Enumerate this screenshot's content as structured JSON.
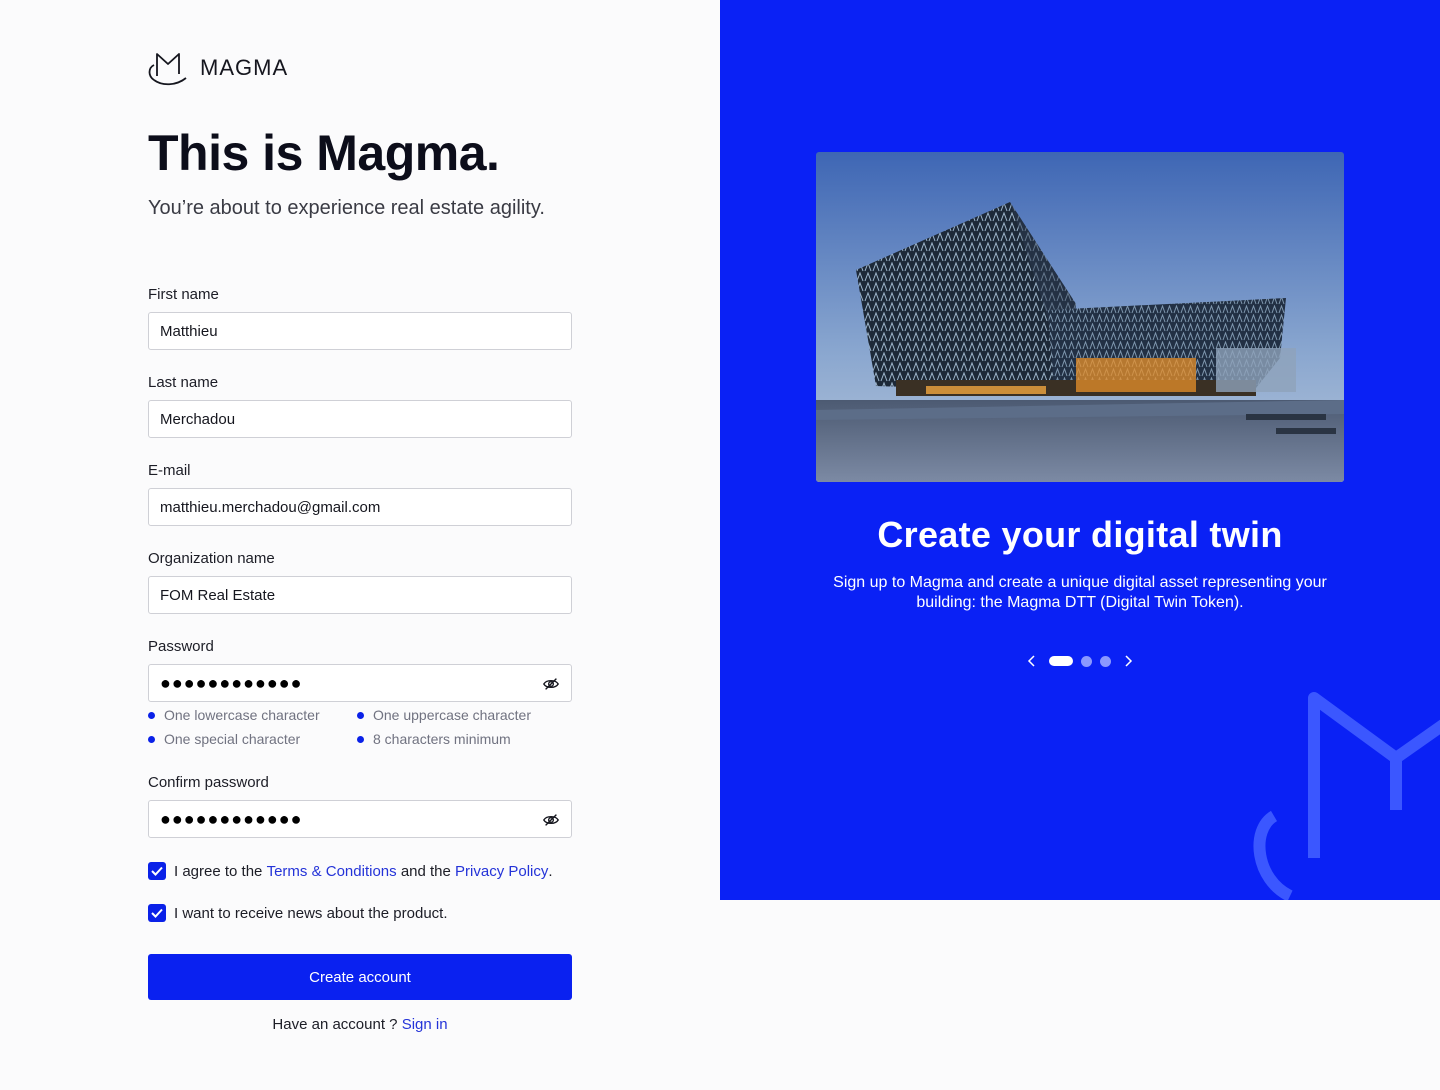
{
  "brand": {
    "name": "MAGMA",
    "logo_icon": "magma-logo-icon"
  },
  "hero": {
    "title": "This is Magma.",
    "subtitle": "You’re about to experience real estate agility."
  },
  "form": {
    "first_name": {
      "label": "First name",
      "value": "Matthieu"
    },
    "last_name": {
      "label": "Last name",
      "value": "Merchadou"
    },
    "email": {
      "label": "E-mail",
      "value": "matthieu.merchadou@gmail.com"
    },
    "organization": {
      "label": "Organization name",
      "value": "FOM Real Estate"
    },
    "password": {
      "label": "Password",
      "value": "●●●●●●●●●●●●",
      "toggle_icon": "eye-off-icon"
    },
    "password_rules": [
      "One lowercase character",
      "One uppercase character",
      "One special character",
      "8 characters minimum"
    ],
    "confirm_password": {
      "label": "Confirm password",
      "value": "●●●●●●●●●●●●",
      "toggle_icon": "eye-off-icon"
    },
    "agree": {
      "checked": true,
      "prefix": "I agree to the",
      "terms_link": "Terms & Conditions",
      "middle": "and the",
      "privacy_link": "Privacy Policy",
      "suffix": "."
    },
    "news": {
      "checked": true,
      "label": "I want to receive news about the product."
    },
    "submit_label": "Create account",
    "signin_prompt": "Have an account ?",
    "signin_link": "Sign in"
  },
  "slide": {
    "title": "Create your digital twin",
    "description": "Sign up to Magma and create a unique digital asset representing your building: the Magma DTT (Digital Twin Token).",
    "prev_icon": "chevron-left-icon",
    "next_icon": "chevron-right-icon",
    "active_index": 0,
    "count": 3
  },
  "colors": {
    "accent": "#0a21f5",
    "link": "#2433d8",
    "text": "#15161e",
    "muted": "#707280"
  }
}
